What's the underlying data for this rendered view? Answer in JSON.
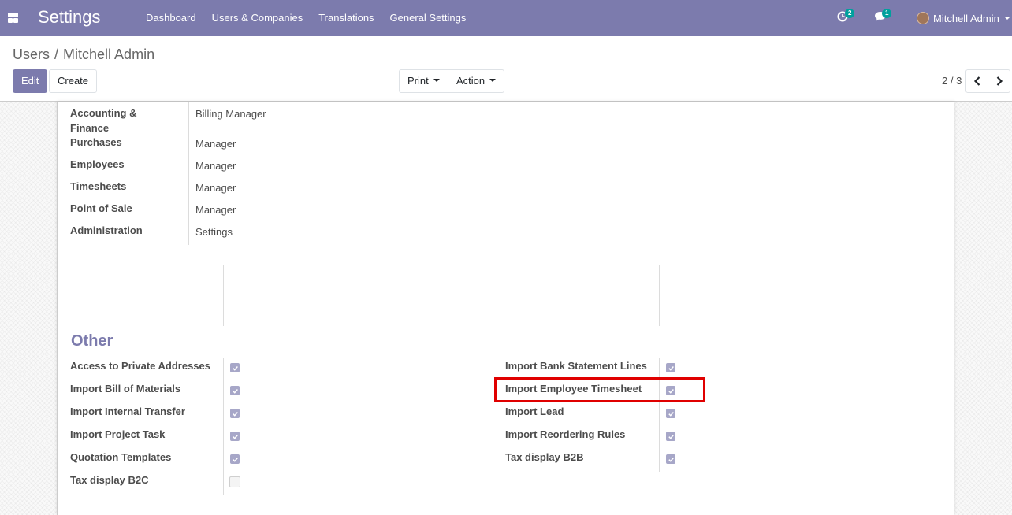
{
  "app": {
    "name": "Settings"
  },
  "nav": {
    "menu": [
      "Dashboard",
      "Users & Companies",
      "Translations",
      "General Settings"
    ]
  },
  "systray": {
    "activity_count": "2",
    "message_count": "1",
    "user_name": "Mitchell Admin"
  },
  "breadcrumb": {
    "parent": "Users",
    "separator": "/",
    "current": "Mitchell Admin"
  },
  "toolbar": {
    "edit_label": "Edit",
    "create_label": "Create",
    "print_label": "Print",
    "action_label": "Action"
  },
  "pager": {
    "value": "2 / 3"
  },
  "access_rights": [
    {
      "label": "Accounting & Finance",
      "value": "Billing Manager"
    },
    {
      "label": "Purchases",
      "value": "Manager"
    },
    {
      "label": "Employees",
      "value": "Manager"
    },
    {
      "label": "Timesheets",
      "value": "Manager"
    },
    {
      "label": "Point of Sale",
      "value": "Manager"
    },
    {
      "label": "Administration",
      "value": "Settings"
    }
  ],
  "other": {
    "title": "Other",
    "left": [
      {
        "label": "Access to Private Addresses",
        "checked": true
      },
      {
        "label": "Import Bill of Materials",
        "checked": true
      },
      {
        "label": "Import Internal Transfer",
        "checked": true
      },
      {
        "label": "Import Project Task",
        "checked": true
      },
      {
        "label": "Quotation Templates",
        "checked": true
      },
      {
        "label": "Tax display B2C",
        "checked": false
      }
    ],
    "right": [
      {
        "label": "Import Bank Statement Lines",
        "checked": true
      },
      {
        "label": "Import Employee Timesheet",
        "checked": true
      },
      {
        "label": "Import Lead",
        "checked": true
      },
      {
        "label": "Import Reordering Rules",
        "checked": true
      },
      {
        "label": "Tax display B2B",
        "checked": true
      }
    ]
  },
  "colors": {
    "navbar": "#7c7bad",
    "highlight": "#e00000",
    "checkbox": "#a7a7c8"
  }
}
